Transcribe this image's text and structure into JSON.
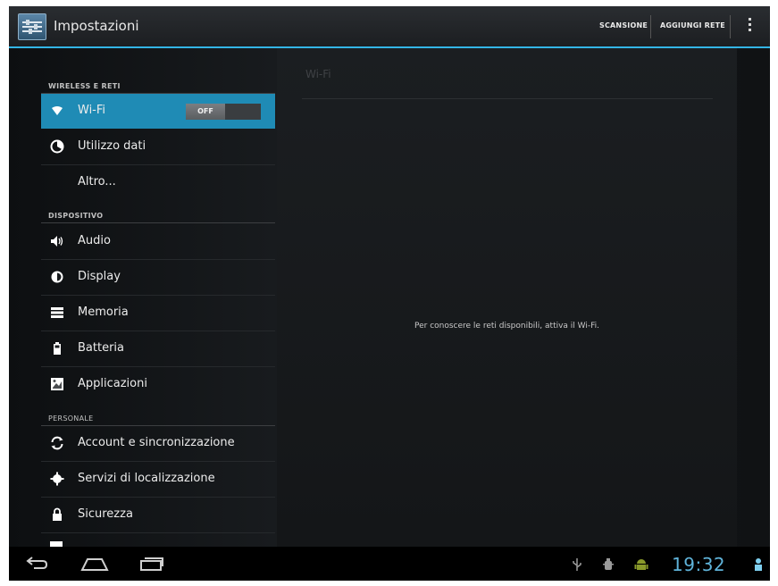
{
  "actionbar": {
    "title": "Impostazioni",
    "actions": {
      "scan": "SCANSIONE",
      "add_network": "AGGIUNGI RETE"
    },
    "icons": {
      "app": "settings-icon",
      "overflow": "overflow-menu-icon"
    },
    "accent_color": "#33b5e5"
  },
  "sidebar": {
    "sections": {
      "wireless": "WIRELESS E RETI",
      "device": "DISPOSITIVO",
      "personal": "PERSONALE"
    },
    "items": {
      "wifi": {
        "label": "Wi-Fi",
        "icon": "wifi-icon",
        "toggle": "OFF"
      },
      "data_usage": {
        "label": "Utilizzo dati",
        "icon": "data-usage-icon"
      },
      "more": {
        "label": "Altro..."
      },
      "audio": {
        "label": "Audio",
        "icon": "speaker-icon"
      },
      "display": {
        "label": "Display",
        "icon": "brightness-icon"
      },
      "storage": {
        "label": "Memoria",
        "icon": "storage-icon"
      },
      "battery": {
        "label": "Batteria",
        "icon": "battery-icon"
      },
      "apps": {
        "label": "Applicazioni",
        "icon": "apps-icon"
      },
      "accounts": {
        "label": "Account e sincronizzazione",
        "icon": "sync-icon"
      },
      "location": {
        "label": "Servizi di localizzazione",
        "icon": "location-icon"
      },
      "security": {
        "label": "Sicurezza",
        "icon": "lock-icon"
      }
    },
    "selected_color": "#1f8bb5"
  },
  "detail": {
    "title": "Wi-Fi",
    "message": "Per conoscere le reti disponibili, attiva il Wi-Fi."
  },
  "navbar": {
    "clock": "19:32",
    "clock_color": "#5fb3d9",
    "icons": [
      "back-icon",
      "home-icon",
      "recent-apps-icon",
      "usb-icon",
      "debug-icon",
      "android-icon",
      "user-icon"
    ]
  }
}
